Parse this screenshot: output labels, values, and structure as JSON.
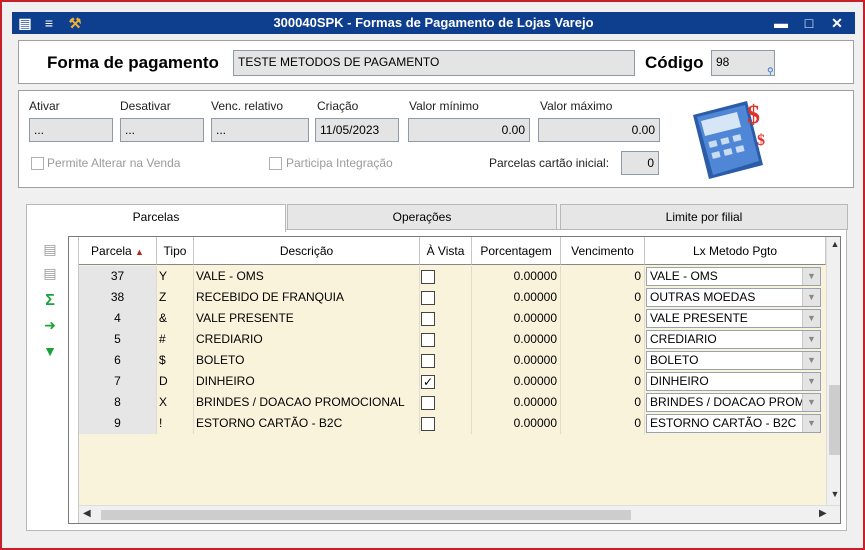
{
  "window": {
    "title": "300040SPK - Formas de Pagamento de Lojas Varejo"
  },
  "header": {
    "forma_label": "Forma de pagamento",
    "forma_value": "TESTE METODOS DE PAGAMENTO",
    "codigo_label": "Código",
    "codigo_value": "98"
  },
  "details": {
    "ativar_label": "Ativar",
    "ativar_value": "...",
    "desativar_label": "Desativar",
    "desativar_value": "...",
    "venc_label": "Venc. relativo",
    "venc_value": "...",
    "criacao_label": "Criação",
    "criacao_value": "11/05/2023",
    "valor_min_label": "Valor mínimo",
    "valor_min_value": "0.00",
    "valor_max_label": "Valor máximo",
    "valor_max_value": "0.00",
    "permite_label": "Permite Alterar na Venda",
    "participa_label": "Participa Integração",
    "parcelas_label": "Parcelas cartão inicial:",
    "parcelas_value": "0"
  },
  "tabs": [
    {
      "label": "Parcelas"
    },
    {
      "label": "Operações"
    },
    {
      "label": "Limite por filial"
    }
  ],
  "grid": {
    "columns": [
      "Parcela",
      "Tipo",
      "Descrição",
      "À Vista",
      "Porcentagem",
      "Vencimento",
      "Lx Metodo Pgto"
    ],
    "rows": [
      {
        "parcela": "37",
        "tipo": "Y",
        "descricao": "VALE - OMS",
        "a_vista": false,
        "porcentagem": "0.00000",
        "vencimento": "0",
        "lx": "VALE - OMS"
      },
      {
        "parcela": "38",
        "tipo": "Z",
        "descricao": "RECEBIDO DE FRANQUIA",
        "a_vista": false,
        "porcentagem": "0.00000",
        "vencimento": "0",
        "lx": "OUTRAS MOEDAS"
      },
      {
        "parcela": "4",
        "tipo": "&",
        "descricao": "VALE PRESENTE",
        "a_vista": false,
        "porcentagem": "0.00000",
        "vencimento": "0",
        "lx": "VALE PRESENTE"
      },
      {
        "parcela": "5",
        "tipo": "#",
        "descricao": "CREDIARIO",
        "a_vista": false,
        "porcentagem": "0.00000",
        "vencimento": "0",
        "lx": "CREDIARIO"
      },
      {
        "parcela": "6",
        "tipo": "$",
        "descricao": "BOLETO",
        "a_vista": false,
        "porcentagem": "0.00000",
        "vencimento": "0",
        "lx": "BOLETO"
      },
      {
        "parcela": "7",
        "tipo": "D",
        "descricao": "DINHEIRO",
        "a_vista": true,
        "porcentagem": "0.00000",
        "vencimento": "0",
        "lx": "DINHEIRO"
      },
      {
        "parcela": "8",
        "tipo": "X",
        "descricao": "BRINDES / DOACAO PROMOCIONAL",
        "a_vista": false,
        "porcentagem": "0.00000",
        "vencimento": "0",
        "lx": "BRINDES / DOACAO PROM"
      },
      {
        "parcela": "9",
        "tipo": "!",
        "descricao": "ESTORNO CARTÃO - B2C",
        "a_vista": false,
        "porcentagem": "0.00000",
        "vencimento": "0",
        "lx": "ESTORNO CARTÃO - B2C"
      }
    ]
  },
  "colors": {
    "titlebar": "#0e3f8f",
    "row_bg": "#faf3dc",
    "sum_icon": "#1aa33a"
  }
}
